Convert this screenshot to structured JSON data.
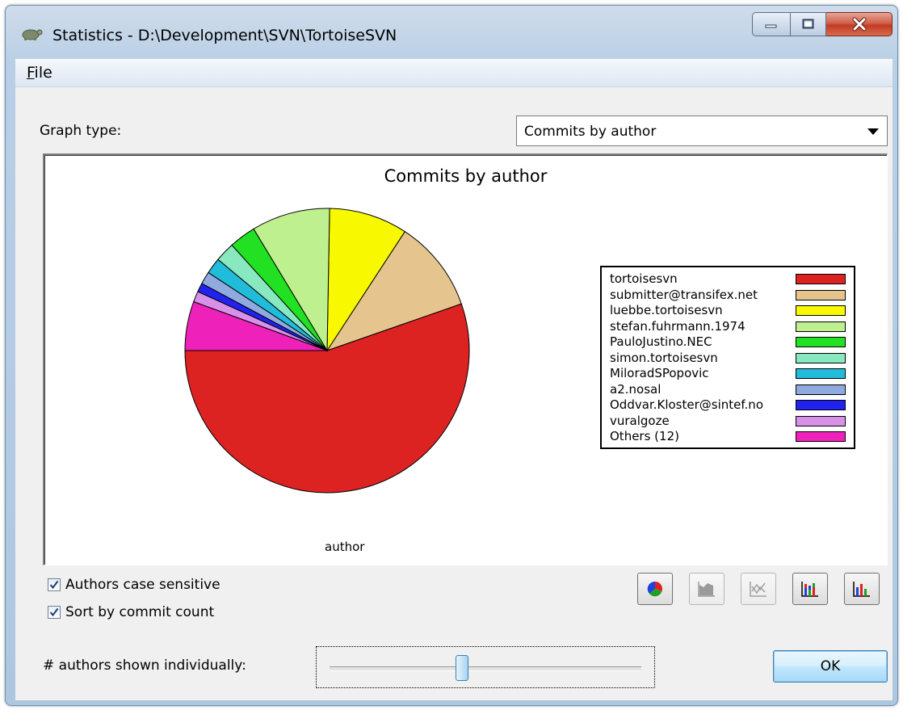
{
  "window": {
    "title": "Statistics - D:\\Development\\SVN\\TortoiseSVN",
    "controls": {
      "minimize_icon": "minimize-icon",
      "maximize_icon": "maximize-icon",
      "close_icon": "close-icon"
    }
  },
  "menu": {
    "file_first": "F",
    "file_rest": "ile"
  },
  "graph_type": {
    "label": "Graph type:",
    "selected": "Commits by author"
  },
  "chart_data": {
    "type": "pie",
    "title": "Commits by author",
    "xlabel": "author",
    "legend_position": "right",
    "categories": [
      "tortoisesvn",
      "submitter@transifex.net",
      "luebbe.tortoisesvn",
      "stefan.fuhrmann.1974",
      "PauloJustino.NEC",
      "simon.tortoisesvn",
      "MiloradSPopovic",
      "a2.nosal",
      "Oddvar.Kloster@sintef.no",
      "vuralgoze",
      "Others (12)"
    ],
    "values": [
      54.5,
      10.3,
      8.8,
      8.8,
      3.0,
      2.2,
      1.8,
      1.4,
      1.0,
      1.2,
      5.5
    ],
    "colors": [
      "#dd2222",
      "#e6c48e",
      "#f8f800",
      "#bff08f",
      "#22e022",
      "#88e8c0",
      "#22bcdb",
      "#8faade",
      "#2222ee",
      "#d890e8",
      "#ee22bb"
    ]
  },
  "options": {
    "authors_case_sensitive": "Authors case sensitive",
    "sort_by_commit_count": "Sort by commit count"
  },
  "toolbar_icons": {
    "pie": "pie-chart-icon",
    "area": "area-chart-icon",
    "line": "line-chart-icon",
    "stacked_bar": "stacked-bar-chart-icon",
    "bar": "bar-chart-icon"
  },
  "slider": {
    "label": "# authors shown individually:",
    "value_fraction": 0.42
  },
  "ok_label": "OK"
}
